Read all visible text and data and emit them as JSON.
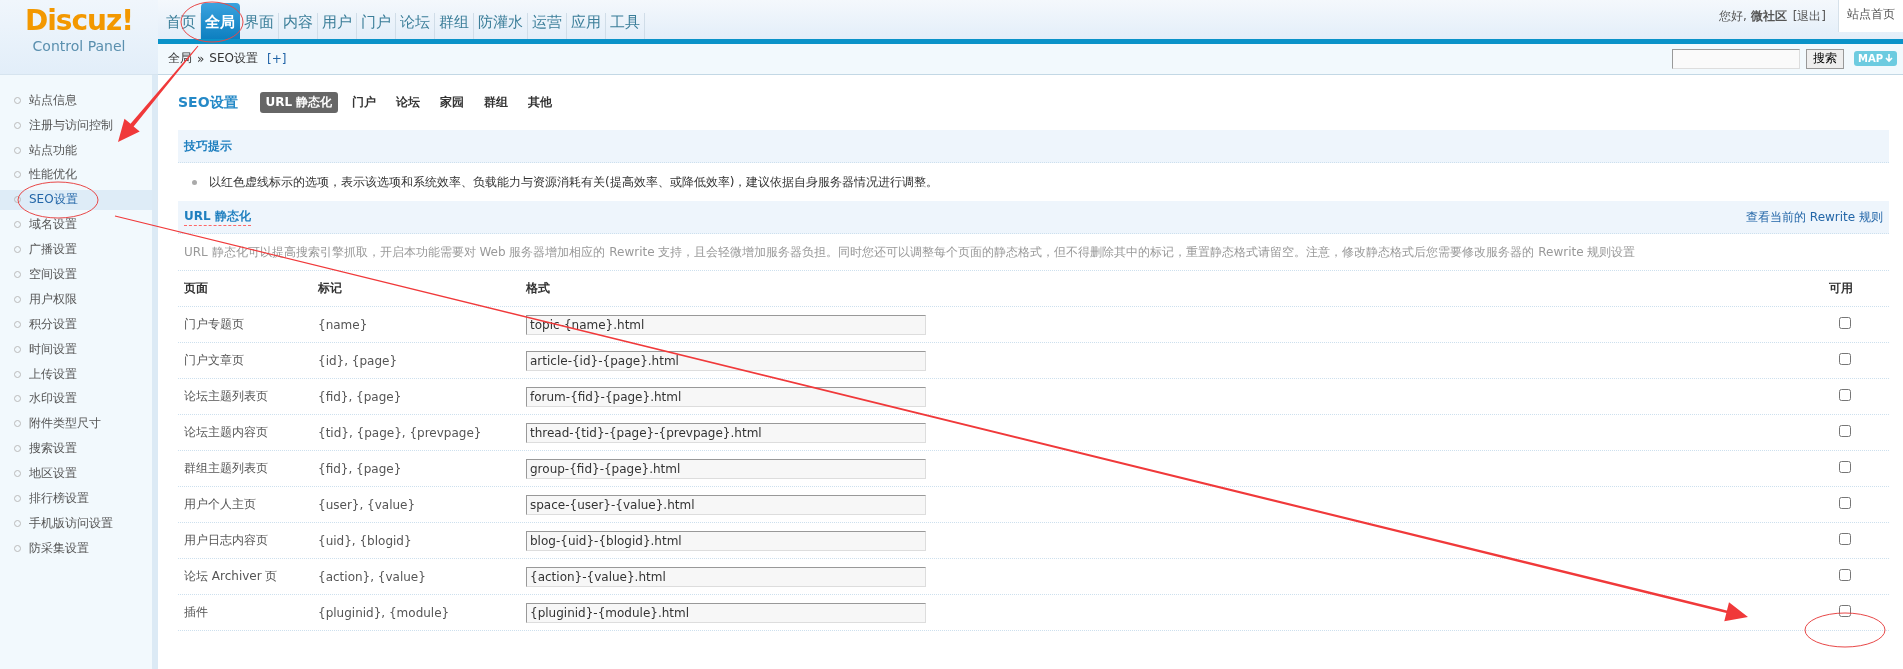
{
  "logo": {
    "title": "Discuz",
    "mark": "!",
    "subtitle": "Control Panel"
  },
  "nav": [
    {
      "label": "首页",
      "selected": false
    },
    {
      "label": "全局",
      "selected": true
    },
    {
      "label": "界面",
      "selected": false
    },
    {
      "label": "内容",
      "selected": false
    },
    {
      "label": "用户",
      "selected": false
    },
    {
      "label": "门户",
      "selected": false
    },
    {
      "label": "论坛",
      "selected": false
    },
    {
      "label": "群组",
      "selected": false
    },
    {
      "label": "防灌水",
      "selected": false
    },
    {
      "label": "运营",
      "selected": false
    },
    {
      "label": "应用",
      "selected": false
    },
    {
      "label": "工具",
      "selected": false
    }
  ],
  "user_bar": {
    "greeting": "您好, **微社区**",
    "logout": "[退出]",
    "home": "站点首页"
  },
  "breadcrumb": {
    "root": "全局",
    "separator": "»",
    "current": "SEO设置",
    "add": "[+]"
  },
  "search": {
    "button": "搜索",
    "map": "MAP"
  },
  "sidebar": {
    "items": [
      {
        "label": "站点信息",
        "selected": false
      },
      {
        "label": "注册与访问控制",
        "selected": false
      },
      {
        "label": "站点功能",
        "selected": false
      },
      {
        "label": "性能优化",
        "selected": false
      },
      {
        "label": "SEO设置",
        "selected": true
      },
      {
        "label": "域名设置",
        "selected": false
      },
      {
        "label": "广播设置",
        "selected": false
      },
      {
        "label": "空间设置",
        "selected": false
      },
      {
        "label": "用户权限",
        "selected": false
      },
      {
        "label": "积分设置",
        "selected": false
      },
      {
        "label": "时间设置",
        "selected": false
      },
      {
        "label": "上传设置",
        "selected": false
      },
      {
        "label": "水印设置",
        "selected": false
      },
      {
        "label": "附件类型尺寸",
        "selected": false
      },
      {
        "label": "搜索设置",
        "selected": false
      },
      {
        "label": "地区设置",
        "selected": false
      },
      {
        "label": "排行榜设置",
        "selected": false
      },
      {
        "label": "手机版访问设置",
        "selected": false
      },
      {
        "label": "防采集设置",
        "selected": false
      }
    ]
  },
  "page": {
    "title": "SEO设置",
    "tabs": [
      {
        "label": "URL 静态化",
        "selected": true
      },
      {
        "label": "门户",
        "selected": false
      },
      {
        "label": "论坛",
        "selected": false
      },
      {
        "label": "家园",
        "selected": false
      },
      {
        "label": "群组",
        "selected": false
      },
      {
        "label": "其他",
        "selected": false
      }
    ]
  },
  "tips": {
    "title": "技巧提示",
    "text": "以红色虚线标示的选项，表示该选项和系统效率、负载能力与资源消耗有关(提高效率、或降低效率)，建议依据自身服务器情况进行调整。"
  },
  "section": {
    "title": "URL 静态化",
    "link": "查看当前的 Rewrite 规则",
    "description": "URL 静态化可以提高搜索引擎抓取，开启本功能需要对 Web 服务器增加相应的 Rewrite 支持，且会轻微增加服务器负担。同时您还可以调整每个页面的静态格式，但不得删除其中的标记，重置静态格式请留空。注意，修改静态格式后您需要修改服务器的 Rewrite 规则设置"
  },
  "table": {
    "columns": [
      "页面",
      "标记",
      "格式",
      "可用"
    ],
    "rows": [
      {
        "page": "门户专题页",
        "marks": "{name}",
        "format": "topic-{name}.html",
        "enabled": false
      },
      {
        "page": "门户文章页",
        "marks": "{id}, {page}",
        "format": "article-{id}-{page}.html",
        "enabled": false
      },
      {
        "page": "论坛主题列表页",
        "marks": "{fid}, {page}",
        "format": "forum-{fid}-{page}.html",
        "enabled": false
      },
      {
        "page": "论坛主题内容页",
        "marks": "{tid}, {page}, {prevpage}",
        "format": "thread-{tid}-{page}-{prevpage}.html",
        "enabled": false
      },
      {
        "page": "群组主题列表页",
        "marks": "{fid}, {page}",
        "format": "group-{fid}-{page}.html",
        "enabled": false
      },
      {
        "page": "用户个人主页",
        "marks": "{user}, {value}",
        "format": "space-{user}-{value}.html",
        "enabled": false
      },
      {
        "page": "用户日志内容页",
        "marks": "{uid}, {blogid}",
        "format": "blog-{uid}-{blogid}.html",
        "enabled": false
      },
      {
        "page": "论坛 Archiver 页",
        "marks": "{action}, {value}",
        "format": "{action}-{value}.html",
        "enabled": false
      },
      {
        "page": "插件",
        "marks": "{pluginid}, {module}",
        "format": "{pluginid}-{module}.html",
        "enabled": false
      }
    ]
  },
  "annotations": [
    {
      "kind": "ellipse"
    },
    {
      "kind": "arrow"
    },
    {
      "kind": "ellipse"
    },
    {
      "kind": "arrow"
    },
    {
      "kind": "ellipse"
    }
  ]
}
